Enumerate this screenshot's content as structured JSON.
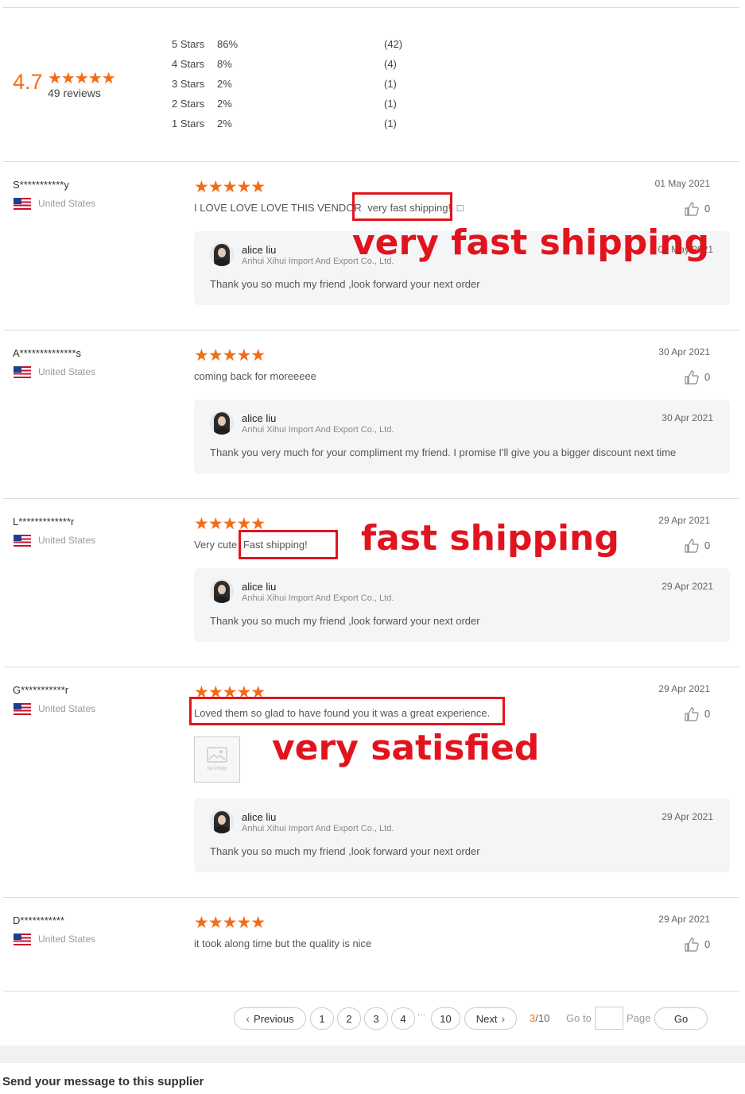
{
  "summary": {
    "score": "4.7",
    "reviews_count": "49 reviews",
    "score_stars_fraction": 0.94,
    "distribution": [
      {
        "label": "5 Stars",
        "percent": "86%",
        "count": "(42)"
      },
      {
        "label": "4 Stars",
        "percent": "8%",
        "count": "(4)"
      },
      {
        "label": "3 Stars",
        "percent": "2%",
        "count": "(1)"
      },
      {
        "label": "2 Stars",
        "percent": "2%",
        "count": "(1)"
      },
      {
        "label": "1 Stars",
        "percent": "2%",
        "count": "(1)"
      }
    ]
  },
  "reviews": [
    {
      "reviewer": "S***********y",
      "country": "United States",
      "rating": 5,
      "date": "01 May 2021",
      "text": "I LOVE LOVE LOVE THIS VENDOR very fast shipping! □",
      "text_before": "I LOVE LOVE LOVE THIS VENDOR",
      "text_highlight": "very fast shipping!",
      "text_after": "□",
      "likes": "0",
      "reply": {
        "name": "alice liu",
        "company": "Anhui Xihui Import And Export Co., Ltd.",
        "date": "04 May 2021",
        "text": "Thank you so much my friend ,look forward your next order"
      },
      "annotation": "very fast shipping"
    },
    {
      "reviewer": "A**************s",
      "country": "United States",
      "rating": 5,
      "date": "30 Apr 2021",
      "text": "coming back for moreeeee",
      "likes": "0",
      "reply": {
        "name": "alice liu",
        "company": "Anhui Xihui Import And Export Co., Ltd.",
        "date": "30 Apr 2021",
        "text": "Thank you very much for your compliment my friend. I promise I'll give you a bigger discount next time"
      }
    },
    {
      "reviewer": "L*************r",
      "country": "United States",
      "rating": 5,
      "date": "29 Apr 2021",
      "text": "Very cute Fast shipping!",
      "text_before": "Very cute",
      "text_highlight": "Fast shipping!",
      "likes": "0",
      "reply": {
        "name": "alice liu",
        "company": "Anhui Xihui Import And Export Co., Ltd.",
        "date": "29 Apr 2021",
        "text": "Thank you so much my friend ,look forward your next order"
      },
      "annotation": "fast shipping"
    },
    {
      "reviewer": "G***********r",
      "country": "United States",
      "rating": 5,
      "date": "29 Apr 2021",
      "text": "Loved them so glad to have found you it was a great experience.",
      "likes": "0",
      "photo_placeholder": "No Photo",
      "reply": {
        "name": "alice liu",
        "company": "Anhui Xihui Import And Export Co., Ltd.",
        "date": "29 Apr 2021",
        "text": "Thank you so much my friend ,look forward your next order"
      },
      "annotation": "very satisfied"
    },
    {
      "reviewer": "D***********",
      "country": "United States",
      "rating": 5,
      "date": "29 Apr 2021",
      "text": "it took along time but the quality is nice",
      "likes": "0"
    }
  ],
  "pagination": {
    "previous": "Previous",
    "pages": [
      "1",
      "2",
      "3",
      "4",
      "10"
    ],
    "ellipsis": "···",
    "next": "Next",
    "current": "3",
    "total": "/10",
    "goto_label": "Go to",
    "goto_value": "",
    "page_label": "Page",
    "go_button": "Go"
  },
  "footer": {
    "send_message": "Send your message to this supplier"
  },
  "colors": {
    "star": "#f36b16",
    "annotation_red": "#e1141e",
    "reply_bg": "#f4f5f6",
    "current_page": "#f36b16"
  }
}
